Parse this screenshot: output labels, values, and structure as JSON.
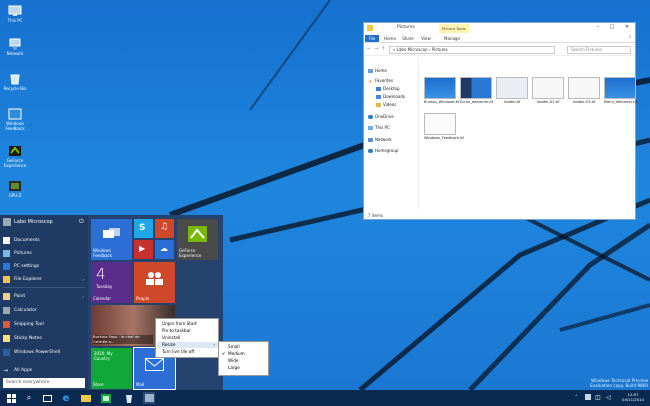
{
  "desktop": {
    "icons": [
      {
        "label": "This PC"
      },
      {
        "label": "Network"
      },
      {
        "label": "Recycle Bin"
      },
      {
        "label": "Windows Feedback"
      },
      {
        "label": "GeForce Experience"
      },
      {
        "label": "GPU-Z"
      }
    ]
  },
  "start": {
    "user": "Labo Microscop",
    "items": [
      "Documents",
      "Pictures",
      "PC settings",
      "File Explorer",
      "Paint",
      "Calculator",
      "Snipping Tool",
      "Sticky Notes",
      "Windows PowerShell"
    ],
    "all_apps": "All Apps",
    "search_placeholder": "Search everywhere",
    "tiles": {
      "feedback": "Windows\nFeedback",
      "geforce": "GeForce\nExperience",
      "calendar_num": "4",
      "calendar_day": "Tuesday",
      "calendar": "Calendar",
      "people": "People",
      "news": "Burkina Faso : le chef de l'armée a...",
      "money": "2020: My\nCountry",
      "store": "Store",
      "mail": "Mail"
    },
    "context_menu": [
      "Unpin from Start",
      "Pin to taskbar",
      "Uninstall",
      "Resize",
      "Turn live tile off"
    ],
    "resize_submenu": [
      "Small",
      "Medium",
      "Wide",
      "Large"
    ],
    "resize_checked": "Medium"
  },
  "explorer": {
    "title": "Pictures",
    "contextual_tab": "Picture Tools",
    "tabs": [
      "File",
      "Home",
      "Share",
      "View",
      "Manage"
    ],
    "path": "« Labo Microscop › Pictures",
    "search_placeholder": "Search Pictures",
    "nav": [
      "Home",
      "Favorites",
      "Desktop",
      "Downloads",
      "Videos",
      "OneDrive",
      "This PC",
      "Network",
      "Homegroup"
    ],
    "files": [
      "Bureau_Windows.tif",
      "Ecran_demarrer.tif",
      "insider.tif",
      "Insider-02.tif",
      "Insider-03.tif",
      "Menu_demarrer.tif",
      "Windows_Feedback.tif"
    ],
    "status": "7 items"
  },
  "watermark": {
    "line1": "Windows Technical Preview",
    "line2": "Evaluation copy. Build 9860"
  },
  "clock": {
    "time": "12:07",
    "date": "04/11/2014"
  },
  "colors": {
    "accent": "#2b78d4",
    "taskbar": "#0b2a52",
    "tile_green": "#11a83a",
    "tile_red": "#d0482a",
    "tile_blue": "#2b6fd6",
    "tile_purple": "#5a2d8c"
  }
}
